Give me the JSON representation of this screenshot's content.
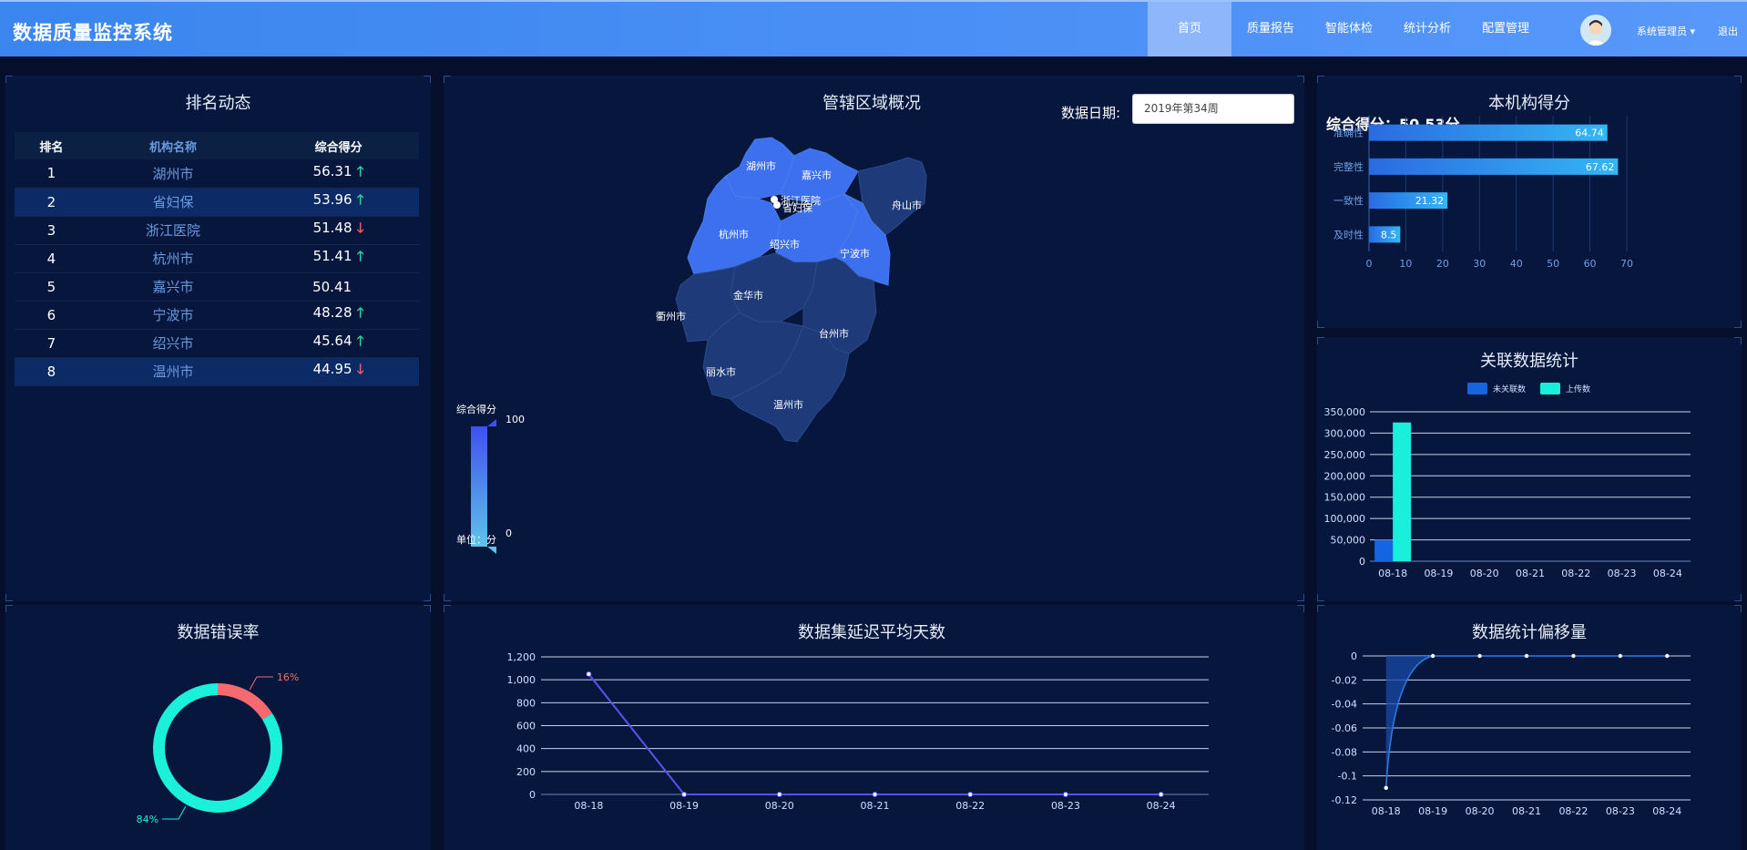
{
  "header": {
    "title": "数据质量监控系统",
    "nav": [
      "首页",
      "质量报告",
      "智能体检",
      "统计分析",
      "配置管理"
    ],
    "user": "系统管理员",
    "logout": "退出"
  },
  "ranking": {
    "title": "排名动态",
    "headers": [
      "排名",
      "机构名称",
      "综合得分"
    ],
    "rows": [
      {
        "rank": "1",
        "name": "湖州市",
        "score": "56.31",
        "trend": "up"
      },
      {
        "rank": "2",
        "name": "省妇保",
        "score": "53.96",
        "trend": "up"
      },
      {
        "rank": "3",
        "name": "浙江医院",
        "score": "51.48",
        "trend": "down"
      },
      {
        "rank": "4",
        "name": "杭州市",
        "score": "51.41",
        "trend": "up"
      },
      {
        "rank": "5",
        "name": "嘉兴市",
        "score": "50.41",
        "trend": "none"
      },
      {
        "rank": "6",
        "name": "宁波市",
        "score": "48.28",
        "trend": "up"
      },
      {
        "rank": "7",
        "name": "绍兴市",
        "score": "45.64",
        "trend": "up"
      },
      {
        "rank": "8",
        "name": "温州市",
        "score": "44.95",
        "trend": "down"
      }
    ]
  },
  "map": {
    "title": "管辖区域概况",
    "date_label": "数据日期:",
    "date_value": "2019年第34周",
    "legend_title": "综合得分",
    "legend_max": "100",
    "legend_min": "0",
    "legend_unit": "单位：分",
    "regions": [
      "湖州市",
      "嘉兴市",
      "舟山市",
      "杭州市",
      "浙江医院",
      "省妇保",
      "绍兴市",
      "宁波市",
      "金华市",
      "衢州市",
      "台州市",
      "丽水市",
      "温州市"
    ],
    "colors": {
      "high": "#3c70ee",
      "low": "#1e3a78"
    }
  },
  "org_score": {
    "title": "本机构得分",
    "total_label": "综合得分：",
    "total_value": "50.53分",
    "chart_data": {
      "type": "bar",
      "orientation": "horizontal",
      "categories": [
        "准确性",
        "完整性",
        "一致性",
        "及时性"
      ],
      "values": [
        64.74,
        67.62,
        21.32,
        8.5
      ],
      "xlim": [
        0,
        70
      ],
      "xticks": [
        0,
        10,
        20,
        30,
        40,
        50,
        60,
        70
      ]
    }
  },
  "relation": {
    "title": "关联数据统计",
    "chart_data": {
      "type": "bar",
      "categories": [
        "08-18",
        "08-19",
        "08-20",
        "08-21",
        "08-22",
        "08-23",
        "08-24"
      ],
      "series": [
        {
          "name": "未关联数",
          "color": "#1565e0",
          "values": [
            50000,
            0,
            0,
            0,
            0,
            0,
            0
          ]
        },
        {
          "name": "上传数",
          "color": "#19f0dc",
          "values": [
            325000,
            0,
            0,
            0,
            0,
            0,
            0
          ]
        }
      ],
      "yticks": [
        "0",
        "50,000",
        "100,000",
        "150,000",
        "200,000",
        "250,000",
        "300,000",
        "350,000"
      ],
      "ylim": [
        0,
        350000
      ]
    }
  },
  "error_rate": {
    "title": "数据错误率",
    "chart_data": {
      "type": "pie",
      "values": [
        16,
        84
      ],
      "labels": [
        "16%",
        "84%"
      ],
      "colors": [
        "#f56a6f",
        "#1af0da"
      ]
    }
  },
  "delay": {
    "title": "数据集延迟平均天数",
    "chart_data": {
      "type": "line",
      "x": [
        "08-18",
        "08-19",
        "08-20",
        "08-21",
        "08-22",
        "08-23",
        "08-24"
      ],
      "values": [
        1050,
        0,
        0,
        0,
        0,
        0,
        0
      ],
      "yticks": [
        "0",
        "200",
        "400",
        "600",
        "800",
        "1,000",
        "1,200"
      ],
      "ylim": [
        0,
        1200
      ]
    }
  },
  "offset": {
    "title": "数据统计偏移量",
    "chart_data": {
      "type": "area",
      "x": [
        "08-18",
        "08-19",
        "08-20",
        "08-21",
        "08-22",
        "08-23",
        "08-24"
      ],
      "values": [
        -0.11,
        0,
        0,
        0,
        0,
        0,
        0
      ],
      "yticks": [
        "0",
        "-0.02",
        "-0.04",
        "-0.06",
        "-0.08",
        "-0.1",
        "-0.12"
      ],
      "ylim": [
        -0.12,
        0
      ]
    }
  }
}
